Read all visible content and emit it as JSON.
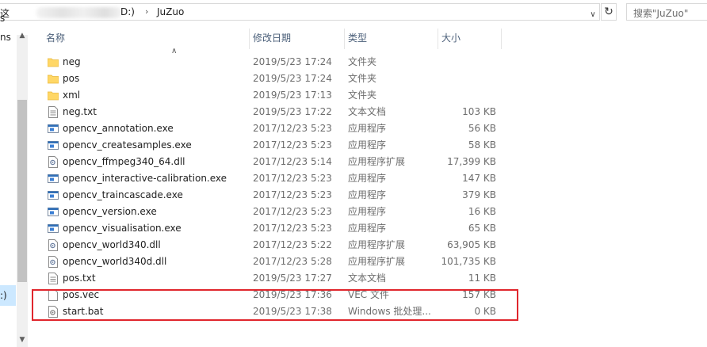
{
  "address": {
    "crumbs": [
      "这",
      "D:)",
      "JuZuo"
    ],
    "search_placeholder": "搜索\"JuZuo\""
  },
  "nav": {
    "labels": [
      "s",
      "ns",
      ":)"
    ]
  },
  "columns": {
    "name": "名称",
    "date": "修改日期",
    "type": "类型",
    "size": "大小"
  },
  "files": [
    {
      "name": "neg",
      "date": "2019/5/23 17:24",
      "type": "文件夹",
      "size": "",
      "icon": "folder-icon"
    },
    {
      "name": "pos",
      "date": "2019/5/23 17:24",
      "type": "文件夹",
      "size": "",
      "icon": "folder-icon"
    },
    {
      "name": "xml",
      "date": "2019/5/23 17:13",
      "type": "文件夹",
      "size": "",
      "icon": "folder-icon"
    },
    {
      "name": "neg.txt",
      "date": "2019/5/23 17:22",
      "type": "文本文档",
      "size": "103 KB",
      "icon": "text-file-icon"
    },
    {
      "name": "opencv_annotation.exe",
      "date": "2017/12/23 5:23",
      "type": "应用程序",
      "size": "56 KB",
      "icon": "exe-icon"
    },
    {
      "name": "opencv_createsamples.exe",
      "date": "2017/12/23 5:23",
      "type": "应用程序",
      "size": "58 KB",
      "icon": "exe-icon"
    },
    {
      "name": "opencv_ffmpeg340_64.dll",
      "date": "2017/12/23 5:14",
      "type": "应用程序扩展",
      "size": "17,399 KB",
      "icon": "dll-icon"
    },
    {
      "name": "opencv_interactive-calibration.exe",
      "date": "2017/12/23 5:23",
      "type": "应用程序",
      "size": "147 KB",
      "icon": "exe-icon"
    },
    {
      "name": "opencv_traincascade.exe",
      "date": "2017/12/23 5:23",
      "type": "应用程序",
      "size": "379 KB",
      "icon": "exe-icon"
    },
    {
      "name": "opencv_version.exe",
      "date": "2017/12/23 5:23",
      "type": "应用程序",
      "size": "16 KB",
      "icon": "exe-icon"
    },
    {
      "name": "opencv_visualisation.exe",
      "date": "2017/12/23 5:23",
      "type": "应用程序",
      "size": "65 KB",
      "icon": "exe-icon"
    },
    {
      "name": "opencv_world340.dll",
      "date": "2017/12/23 5:22",
      "type": "应用程序扩展",
      "size": "63,905 KB",
      "icon": "dll-icon"
    },
    {
      "name": "opencv_world340d.dll",
      "date": "2017/12/23 5:28",
      "type": "应用程序扩展",
      "size": "101,735 KB",
      "icon": "dll-icon"
    },
    {
      "name": "pos.txt",
      "date": "2019/5/23 17:27",
      "type": "文本文档",
      "size": "11 KB",
      "icon": "text-file-icon"
    },
    {
      "name": "pos.vec",
      "date": "2019/5/23 17:36",
      "type": "VEC 文件",
      "size": "157 KB",
      "icon": "blank-file-icon"
    },
    {
      "name": "start.bat",
      "date": "2019/5/23 17:38",
      "type": "Windows 批处理...",
      "size": "0 KB",
      "icon": "bat-file-icon"
    }
  ],
  "colors": {
    "accent": "#e0262d",
    "folder": "#ffd766",
    "header_text": "#4c607a",
    "selection": "#cce8ff"
  }
}
